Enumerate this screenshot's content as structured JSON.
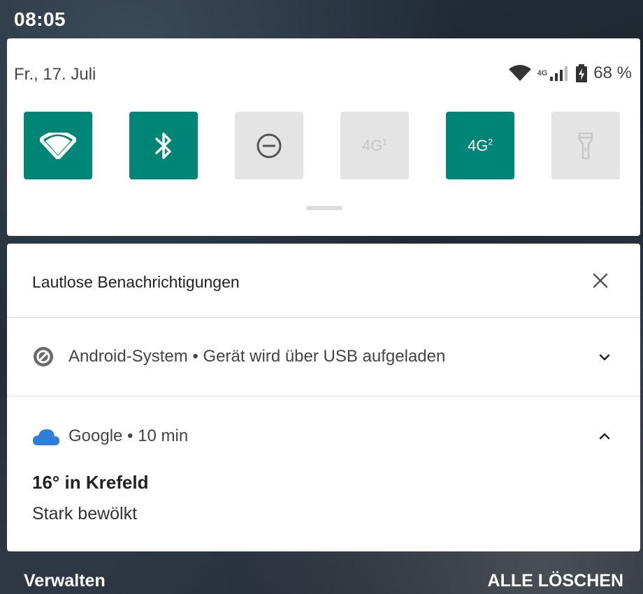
{
  "status_bar": {
    "time": "08:05"
  },
  "quick_settings": {
    "date": "Fr., 17. Juli",
    "network_label": "4G",
    "battery": "68 %",
    "tiles": [
      {
        "name": "wifi",
        "state": "on"
      },
      {
        "name": "bluetooth",
        "state": "on"
      },
      {
        "name": "do-not-disturb",
        "state": "off"
      },
      {
        "name": "sim1-4g",
        "state": "off",
        "label": "4G",
        "sup": "1"
      },
      {
        "name": "sim2-4g",
        "state": "on",
        "label": "4G",
        "sup": "2"
      },
      {
        "name": "flashlight",
        "state": "off"
      }
    ]
  },
  "notifications": {
    "section_title": "Lautlose Benachrichtigungen",
    "android_system": {
      "text": "Android-System • Gerät wird über USB aufgeladen"
    },
    "google": {
      "header": "Google • 10 min",
      "title": "16° in Krefeld",
      "subtitle": "Stark bewölkt"
    }
  },
  "footer": {
    "manage": "Verwalten",
    "clear_all": "ALLE LÖSCHEN"
  },
  "colors": {
    "tile_on": "#008577",
    "tile_off": "#e4e4e4",
    "cloud": "#2f7fd9"
  }
}
